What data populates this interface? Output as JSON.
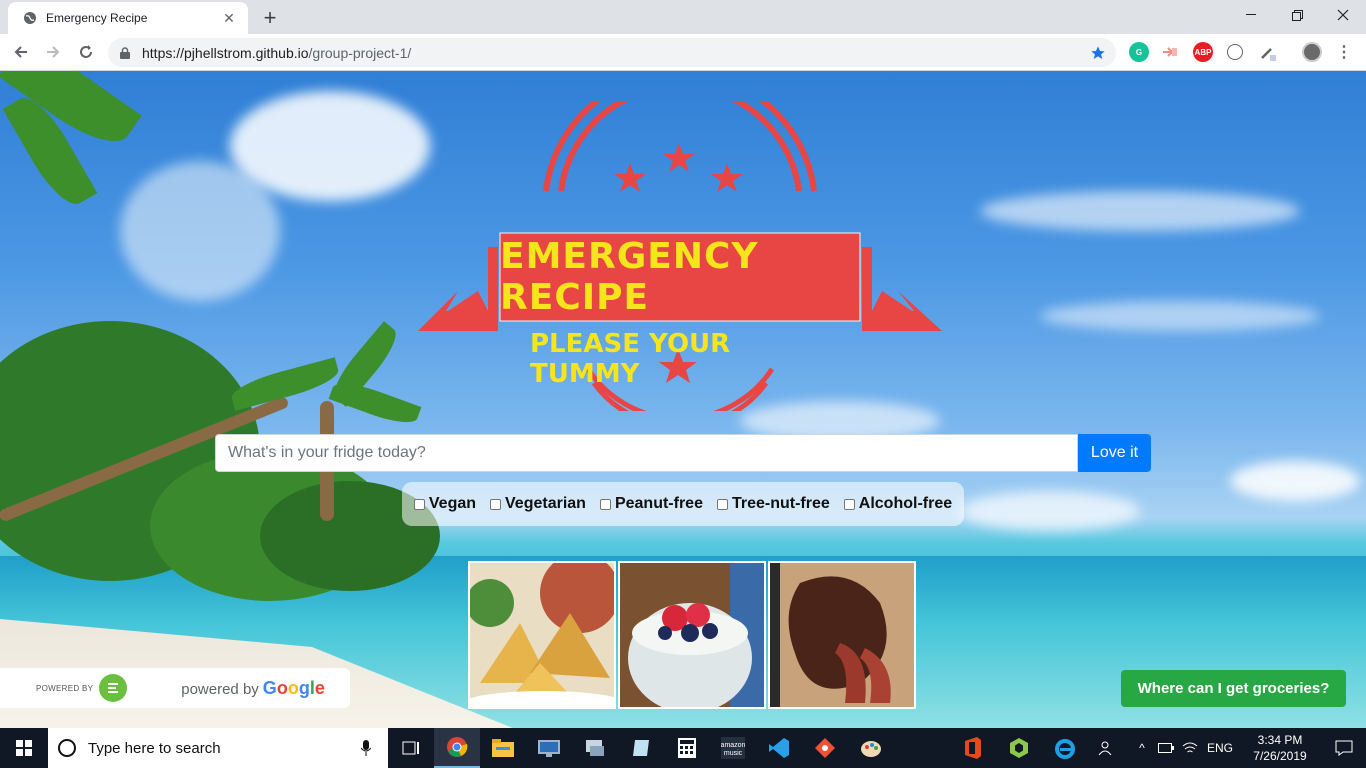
{
  "browser": {
    "tab_title": "Emergency Recipe",
    "url_host": "https://pjhellstrom.github.io",
    "url_path": "/group-project-1/",
    "extensions": [
      {
        "icon": "grammarly-icon",
        "color": "#15c39a",
        "text": "G"
      },
      {
        "icon": "cast-icon",
        "color": "#f28b82",
        "text": ""
      },
      {
        "icon": "adblock-icon",
        "color": "#e51e25",
        "text": "ABP"
      },
      {
        "icon": "extension-icon",
        "color": "#5f6368",
        "text": ""
      },
      {
        "icon": "eyedropper-icon",
        "color": "#5f6368",
        "text": ""
      }
    ]
  },
  "logo": {
    "title": "EMERGENCY RECIPE",
    "subtitle": "PLEASE YOUR TUMMY",
    "banner_color": "#e84545",
    "text_color": "#f7e51b"
  },
  "search": {
    "placeholder": "What's in your fridge today?",
    "button_label": "Love it"
  },
  "filters": [
    "Vegan",
    "Vegetarian",
    "Peanut-free",
    "Tree-nut-free",
    "Alcohol-free"
  ],
  "foods": [
    {
      "name": "samosa-image"
    },
    {
      "name": "yogurt-parfait-image"
    },
    {
      "name": "steak-image"
    }
  ],
  "footer": {
    "edamam_label": "POWERED BY",
    "google_powered": "powered by",
    "google_word": "Google",
    "grocery_button": "Where can I get groceries?"
  },
  "taskbar": {
    "search_placeholder": "Type here to search",
    "language": "ENG",
    "time": "3:34 PM",
    "date": "7/26/2019"
  }
}
